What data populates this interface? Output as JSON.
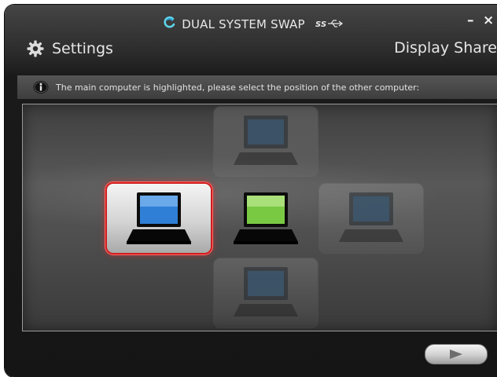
{
  "window": {
    "title": "DUAL SYSTEM SWAP",
    "usb_badge_icon": "usb-superspeed-icon",
    "logo_icon": "swap-logo-icon",
    "minimize_label": "–",
    "close_label": "×"
  },
  "header": {
    "settings_label": "Settings",
    "settings_icon": "gear-icon",
    "display_share_label": "Display Share"
  },
  "info": {
    "icon": "info-icon",
    "message": "The main computer is highlighted, please select the position of the other computer:"
  },
  "positions": [
    {
      "id": "top",
      "state": "inactive",
      "screen_color": "#3d5a73"
    },
    {
      "id": "left",
      "state": "selected",
      "screen_color": "#2f7fd6"
    },
    {
      "id": "center",
      "state": "main",
      "screen_color": "#7ac943"
    },
    {
      "id": "right",
      "state": "inactive",
      "screen_color": "#3d5a73"
    },
    {
      "id": "bottom",
      "state": "inactive",
      "screen_color": "#3d5a73"
    }
  ],
  "footer": {
    "next_icon": "play-arrow-icon"
  },
  "colors": {
    "selection_border": "#d01d1d",
    "main_screen": "#7ac943",
    "selected_screen": "#2f7fd6"
  }
}
